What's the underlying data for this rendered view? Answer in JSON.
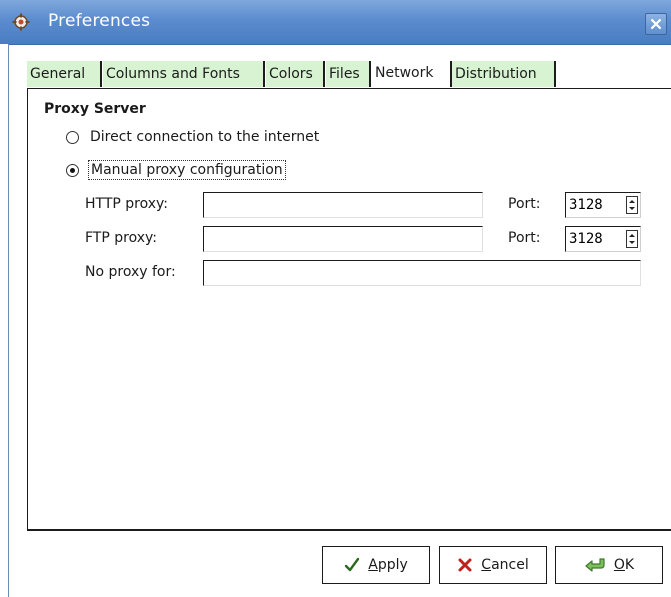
{
  "window": {
    "title": "Preferences",
    "app_icon": "app-gear-icon",
    "close_icon": "close-icon"
  },
  "tabs": [
    {
      "label": "General",
      "active": false
    },
    {
      "label": "Columns and Fonts",
      "active": false
    },
    {
      "label": "Colors",
      "active": false
    },
    {
      "label": "Files",
      "active": false
    },
    {
      "label": "Network",
      "active": true
    },
    {
      "label": "Distribution",
      "active": false
    }
  ],
  "network": {
    "section_title": "Proxy Server",
    "direct_option": {
      "label": "Direct connection to the internet",
      "checked": false
    },
    "manual_option": {
      "label": "Manual proxy configuration",
      "checked": true
    },
    "http": {
      "label": "HTTP proxy:",
      "value": "",
      "port_label": "Port:",
      "port": "3128"
    },
    "ftp": {
      "label": "FTP proxy:",
      "value": "",
      "port_label": "Port:",
      "port": "3128"
    },
    "no_proxy": {
      "label": "No proxy for:",
      "value": ""
    }
  },
  "buttons": {
    "apply": {
      "mnemonic": "A",
      "rest": "pply",
      "icon": "checkmark-icon"
    },
    "cancel": {
      "mnemonic": "C",
      "rest": "ancel",
      "icon": "red-x-icon"
    },
    "ok": {
      "mnemonic": "O",
      "rest": "K",
      "icon": "green-arrow-icon"
    }
  },
  "colors": {
    "titlebar": "#5b8ccf",
    "tab_background": "#d7f3d2",
    "cancel_icon": "#c0221b",
    "ok_icon": "#4f9a3a"
  }
}
